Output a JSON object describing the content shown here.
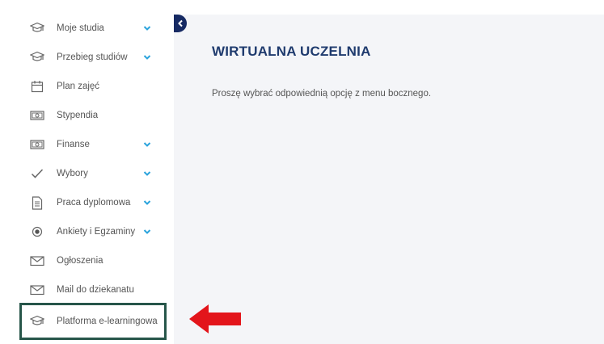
{
  "sidebar": {
    "items": [
      {
        "label": "Moje studia",
        "icon": "graduation-cap-icon",
        "has_submenu": true
      },
      {
        "label": "Przebieg studiów",
        "icon": "graduation-cap-icon",
        "has_submenu": true
      },
      {
        "label": "Plan zajęć",
        "icon": "calendar-icon",
        "has_submenu": false
      },
      {
        "label": "Stypendia",
        "icon": "money-icon",
        "has_submenu": false
      },
      {
        "label": "Finanse",
        "icon": "money-icon",
        "has_submenu": true
      },
      {
        "label": "Wybory",
        "icon": "checkmark-icon",
        "has_submenu": true
      },
      {
        "label": "Praca dyplomowa",
        "icon": "document-icon",
        "has_submenu": true
      },
      {
        "label": "Ankiety i Egzaminy",
        "icon": "radio-icon",
        "has_submenu": true
      },
      {
        "label": "Ogłoszenia",
        "icon": "envelope-icon",
        "has_submenu": false
      },
      {
        "label": "Mail do dziekanatu",
        "icon": "envelope-icon",
        "has_submenu": false
      },
      {
        "label": "Platforma e-learningowa",
        "icon": "graduation-cap-icon",
        "has_submenu": false,
        "highlighted": true
      }
    ]
  },
  "main": {
    "title": "WIRTUALNA UCZELNIA",
    "message": "Proszę wybrać odpowiednią opcję z menu bocznego."
  },
  "colors": {
    "title": "#1f3b6e",
    "chevron": "#2aa3dc",
    "collapse_button": "#162a63",
    "highlight_border": "#27564a",
    "arrow": "#e3151b",
    "content_bg": "#f4f5f8"
  }
}
